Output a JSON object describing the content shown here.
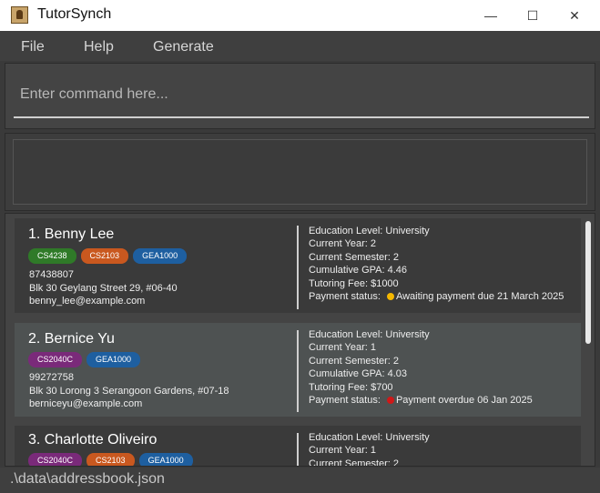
{
  "window": {
    "title": "TutorSynch",
    "minimize": "—",
    "maximize": "☐",
    "close": "✕"
  },
  "menu": [
    "File",
    "Help",
    "Generate"
  ],
  "command": {
    "placeholder": "Enter command here...",
    "value": ""
  },
  "labels": {
    "education": "Education Level: ",
    "year": "Current Year: ",
    "semester": "Current Semester: ",
    "gpa": "Cumulative GPA: ",
    "fee": "Tutoring Fee: ",
    "payment": "Payment status: "
  },
  "students": [
    {
      "index": "1.",
      "name": "Benny Lee",
      "tags": [
        {
          "label": "CS4238",
          "color": "green"
        },
        {
          "label": "CS2103",
          "color": "orange"
        },
        {
          "label": "GEA1000",
          "color": "blue"
        }
      ],
      "phone": "87438807",
      "address": "Blk 30 Geylang Street 29, #06-40",
      "email": "benny_lee@example.com",
      "education": "University",
      "year": "2",
      "semester": "2",
      "gpa": "4.46",
      "fee": "$1000",
      "payment": "Awaiting payment due 21 March 2025",
      "payment_color": "#f5b800"
    },
    {
      "index": "2.",
      "name": "Bernice Yu",
      "tags": [
        {
          "label": "CS2040C",
          "color": "purple"
        },
        {
          "label": "GEA1000",
          "color": "blue"
        }
      ],
      "phone": "99272758",
      "address": "Blk 30 Lorong 3 Serangoon Gardens, #07-18",
      "email": "berniceyu@example.com",
      "education": "University",
      "year": "1",
      "semester": "2",
      "gpa": "4.03",
      "fee": "$700",
      "payment": "Payment overdue 06 Jan 2025",
      "payment_color": "#d01818"
    },
    {
      "index": "3.",
      "name": "Charlotte Oliveiro",
      "tags": [
        {
          "label": "CS2040C",
          "color": "purple"
        },
        {
          "label": "CS2103",
          "color": "orange"
        },
        {
          "label": "GEA1000",
          "color": "blue"
        }
      ],
      "education": "University",
      "year": "1",
      "semester": "2"
    }
  ],
  "status_bar": ".\\data\\addressbook.json"
}
